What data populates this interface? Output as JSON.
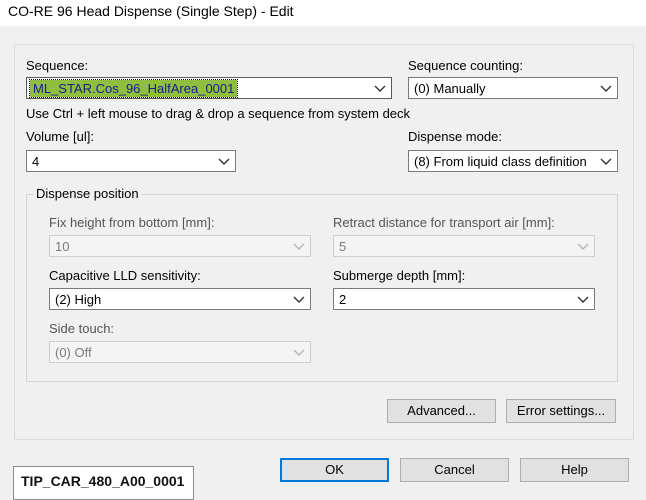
{
  "window": {
    "title": "CO-RE 96 Head Dispense (Single Step) - Edit"
  },
  "sequence": {
    "label": "Sequence:",
    "value": "ML_STAR.Cos_96_HalfArea_0001",
    "hint": "Use Ctrl + left mouse to drag & drop a sequence from system deck"
  },
  "sequence_counting": {
    "label": "Sequence counting:",
    "value": "(0) Manually"
  },
  "volume": {
    "label": "Volume [ul]:",
    "value": "4"
  },
  "dispense_mode": {
    "label": "Dispense mode:",
    "value": "(8) From liquid class definition"
  },
  "dispense_position": {
    "legend": "Dispense position",
    "fix_height": {
      "label": "Fix height from bottom [mm]:",
      "value": "10"
    },
    "retract_distance": {
      "label": "Retract distance for transport air [mm]:",
      "value": "5"
    },
    "capacitive_lld": {
      "label": "Capacitive LLD sensitivity:",
      "value": "(2) High"
    },
    "submerge_depth": {
      "label": "Submerge depth [mm]:",
      "value": "2"
    },
    "side_touch": {
      "label": "Side touch:",
      "value": "(0) Off"
    }
  },
  "buttons": {
    "advanced": "Advanced...",
    "error_settings": "Error settings...",
    "ok": "OK",
    "cancel": "Cancel",
    "help": "Help"
  },
  "status_box": {
    "text": "TIP_CAR_480_A00_0001"
  },
  "icons": {
    "dropdown": "chevron-down-icon"
  },
  "colors": {
    "selection": "#8fbf3f",
    "default_button_border": "#0078d7"
  }
}
